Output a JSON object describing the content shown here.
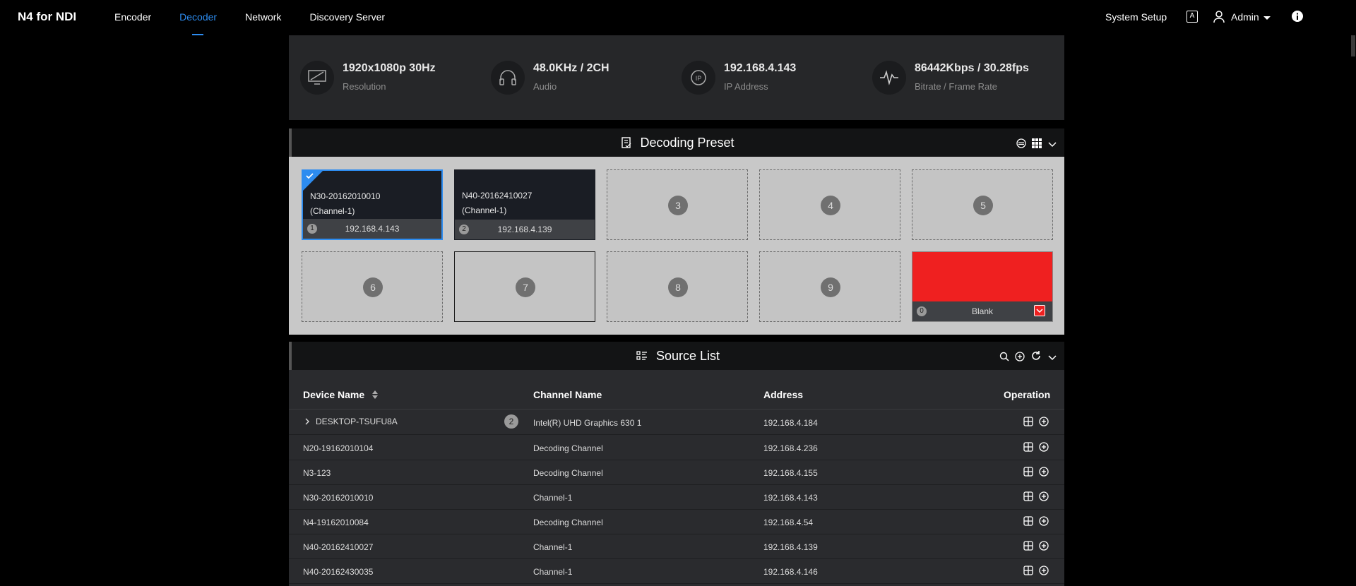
{
  "app": {
    "title": "N4 for NDI"
  },
  "nav": {
    "items": [
      {
        "label": "Encoder"
      },
      {
        "label": "Decoder"
      },
      {
        "label": "Network"
      },
      {
        "label": "Discovery Server"
      }
    ]
  },
  "topright": {
    "system_setup": "System Setup",
    "user": "Admin"
  },
  "stats": [
    {
      "value": "1920x1080p 30Hz",
      "label": "Resolution",
      "icon": "monitor-icon"
    },
    {
      "value": "48.0KHz / 2CH",
      "label": "Audio",
      "icon": "headphones-icon"
    },
    {
      "value": "192.168.4.143",
      "label": "IP Address",
      "icon": "ip-icon"
    },
    {
      "value": "86442Kbps / 30.28fps",
      "label": "Bitrate / Frame Rate",
      "icon": "pulse-icon"
    }
  ],
  "preset": {
    "title": "Decoding Preset",
    "tiles": [
      {
        "index": "1",
        "name_line1": "N30-20162010010",
        "name_line2": "(Channel-1)",
        "ip": "192.168.4.143"
      },
      {
        "index": "2",
        "name_line1": "N40-20162410027",
        "name_line2": "(Channel-1)",
        "ip": "192.168.4.139"
      },
      {
        "index": "3"
      },
      {
        "index": "4"
      },
      {
        "index": "5"
      },
      {
        "index": "6"
      },
      {
        "index": "7"
      },
      {
        "index": "8"
      },
      {
        "index": "9"
      },
      {
        "index": "0",
        "label": "Blank",
        "color": "#ef2020"
      }
    ]
  },
  "sources": {
    "title": "Source List",
    "columns": {
      "device": "Device Name",
      "channel": "Channel Name",
      "address": "Address",
      "operation": "Operation"
    },
    "rows": [
      {
        "device": "DESKTOP-TSUFU8A",
        "count": "2",
        "channel": "Intel(R) UHD Graphics 630 1",
        "address": "192.168.4.184"
      },
      {
        "device": "N20-19162010104",
        "channel": "Decoding Channel",
        "address": "192.168.4.236"
      },
      {
        "device": "N3-123",
        "channel": "Decoding Channel",
        "address": "192.168.4.155"
      },
      {
        "device": "N30-20162010010",
        "channel": "Channel-1",
        "address": "192.168.4.143"
      },
      {
        "device": "N4-19162010084",
        "channel": "Decoding Channel",
        "address": "192.168.4.54"
      },
      {
        "device": "N40-20162410027",
        "channel": "Channel-1",
        "address": "192.168.4.139"
      },
      {
        "device": "N40-20162430035",
        "channel": "Channel-1",
        "address": "192.168.4.146"
      }
    ]
  },
  "colors": {
    "accent": "#2d8cf0",
    "blank": "#ef2020"
  }
}
